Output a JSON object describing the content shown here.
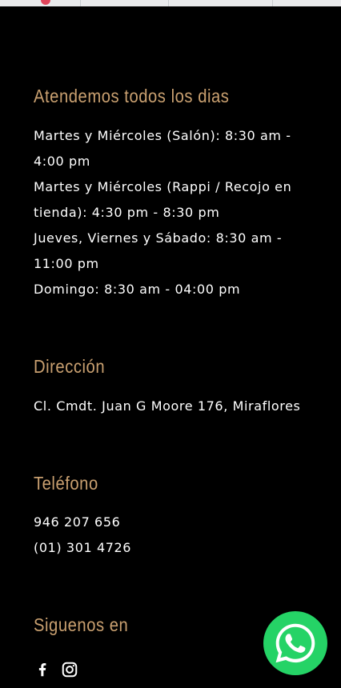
{
  "hours": {
    "title": "Atendemos todos los dias",
    "lines": [
      "Martes y Miércoles (Salón): 8:30 am -",
      "4:00 pm",
      "Martes y Miércoles (Rappi / Recojo en",
      "tienda): 4:30 pm - 8:30 pm",
      "Jueves, Viernes y Sábado: 8:30 am -",
      "11:00 pm",
      "Domingo: 8:30 am - 04:00 pm"
    ]
  },
  "address": {
    "title": "Dirección",
    "text": "Cl. Cmdt. Juan G Moore 176, Miraflores"
  },
  "phone": {
    "title": "Teléfono",
    "numbers": [
      "946 207 656",
      "(01) 301 4726"
    ]
  },
  "social": {
    "title": "Siguenos en",
    "icons": [
      "facebook-icon",
      "instagram-icon"
    ]
  },
  "whatsapp": {
    "icon": "whatsapp-icon",
    "color": "#25d366"
  },
  "colors": {
    "background": "#000000",
    "heading": "#c9a070",
    "text": "#ffffff"
  }
}
